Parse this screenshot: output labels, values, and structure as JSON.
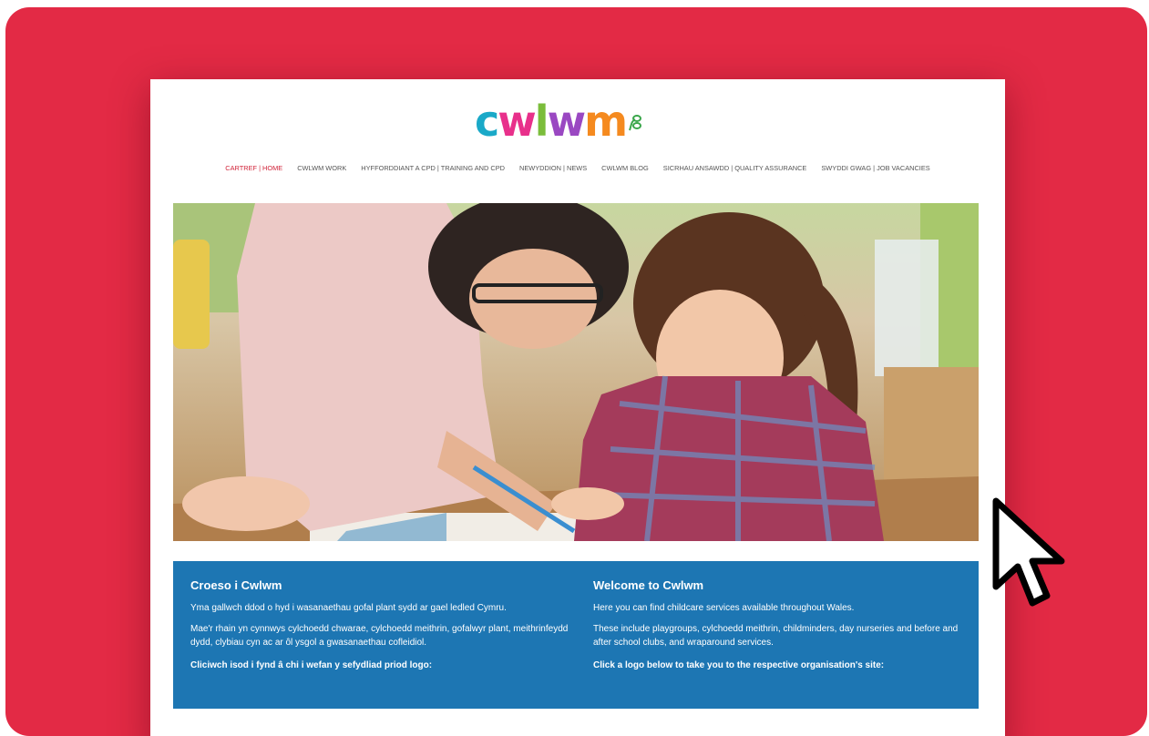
{
  "colors": {
    "frame": "#e32a45",
    "panel": "#1d76b3",
    "nav_active": "#d1243a",
    "nav_text": "#555555"
  },
  "logo": {
    "text": "cwlwm",
    "letters": [
      "c",
      "w",
      "l",
      "w",
      "m"
    ],
    "letter_colors": [
      "#1aa9c8",
      "#e8308b",
      "#7bbd3b",
      "#9a48c2",
      "#f58a1f"
    ],
    "sprout_icon": "sprout-icon"
  },
  "nav": {
    "items": [
      "CARTREF | HOME",
      "CWLWM WORK",
      "HYFFORDDIANT A CPD | TRAINING AND CPD",
      "NEWYDDION | NEWS",
      "CWLWM BLOG",
      "SICRHAU ANSAWDD | QUALITY ASSURANCE",
      "SWYDDI GWAG | JOB VACANCIES"
    ],
    "active_index": 0
  },
  "hero": {
    "image_icon": "teacher-and-child-drawing-photo"
  },
  "welcome": {
    "welsh": {
      "title": "Croeso i Cwlwm",
      "p1": "Yma gallwch ddod o hyd i wasanaethau gofal plant sydd ar gael ledled Cymru.",
      "p2": "Mae'r rhain yn cynnwys cylchoedd chwarae, cylchoedd meithrin, gofalwyr plant, meithrinfeydd dydd, clybiau cyn ac ar ôl ysgol a gwasanaethau cofleidiol.",
      "cta": "Cliciwch isod i fynd â chi i wefan y sefydliad priod logo:"
    },
    "english": {
      "title": "Welcome to Cwlwm",
      "p1": "Here you can find childcare services available throughout Wales.",
      "p2": "These include playgroups, cylchoedd meithrin, childminders, day nurseries and before and after school clubs, and wraparound services.",
      "cta": "Click a logo below to take you to the respective organisation's site:"
    }
  },
  "cursor_icon": "mouse-pointer-icon"
}
